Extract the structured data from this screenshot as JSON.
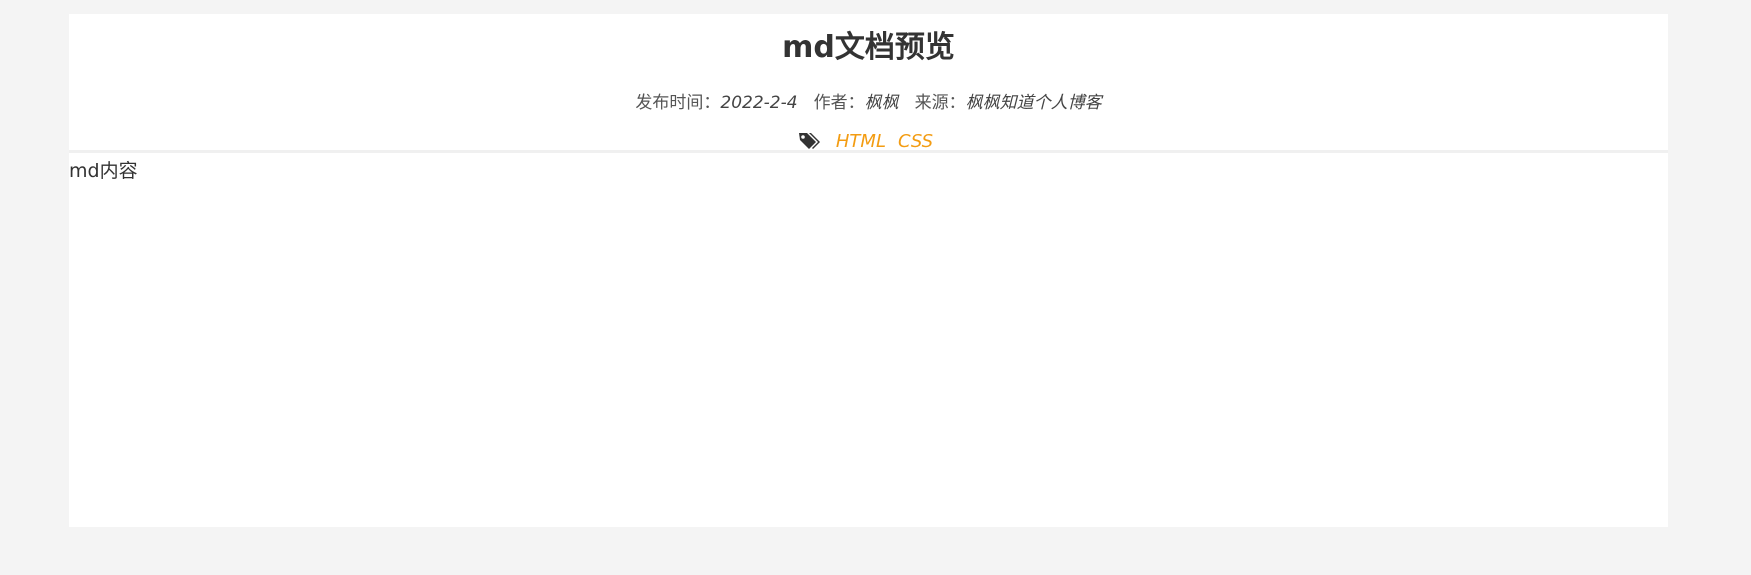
{
  "article": {
    "title": "md文档预览",
    "meta": {
      "publish_label": "发布时间：",
      "publish_date": "2022-2-4",
      "author_label": "作者：",
      "author": "枫枫",
      "source_label": "来源：",
      "source": "枫枫知道个人博客"
    },
    "tags_icon": "tags-icon",
    "tags": [
      "HTML",
      "CSS"
    ],
    "content": "md内容"
  },
  "colors": {
    "page_background": "#f4f4f4",
    "card_background": "#ffffff",
    "tag_color": "#f39c12",
    "text_color": "#333333"
  }
}
